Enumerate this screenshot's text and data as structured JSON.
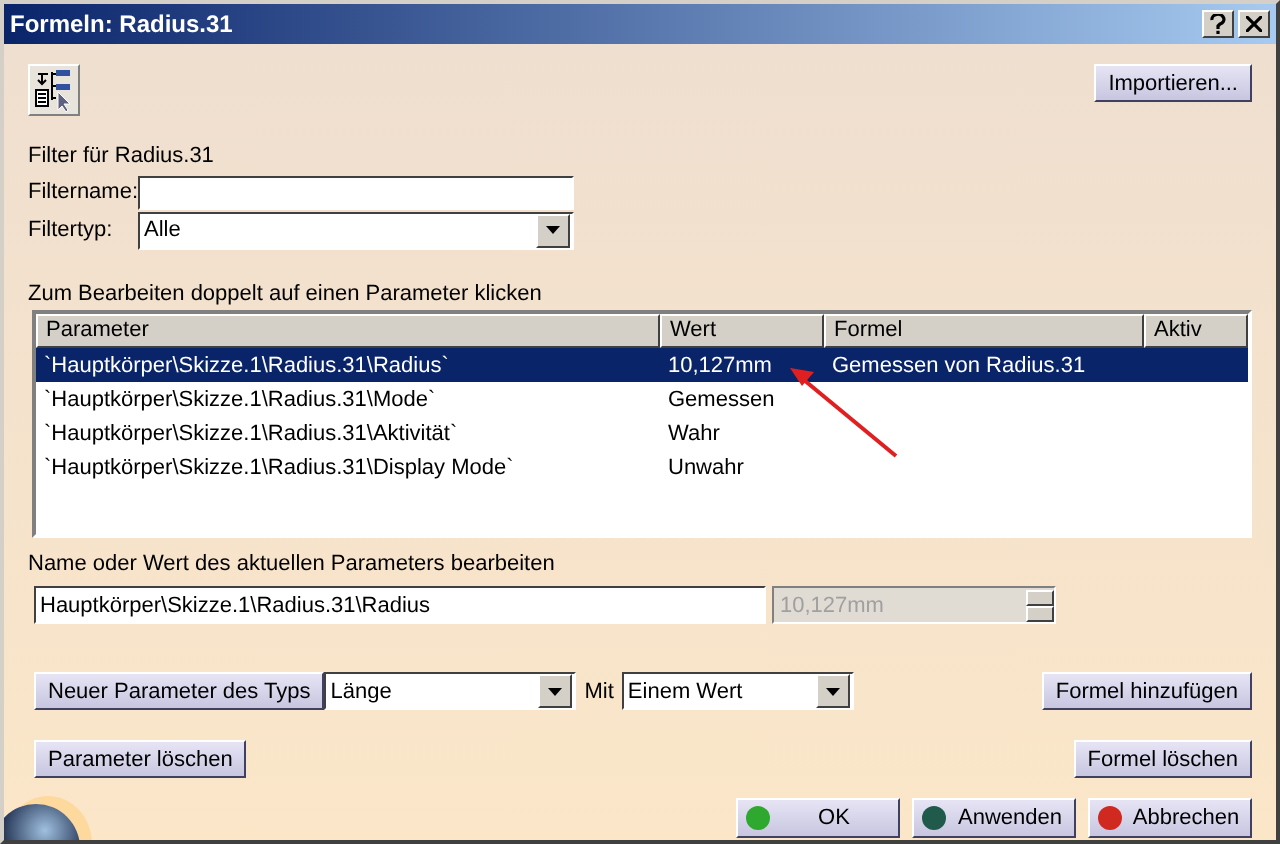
{
  "window": {
    "title": "Formeln: Radius.31"
  },
  "import_button": "Importieren...",
  "filter": {
    "heading": "Filter für Radius.31",
    "name_label": "Filtername:",
    "type_label": "Filtertyp:",
    "type_value": "Alle"
  },
  "table": {
    "caption": "Zum Bearbeiten doppelt auf einen Parameter klicken",
    "columns": [
      "Parameter",
      "Wert",
      "Formel",
      "Aktiv"
    ],
    "rows": [
      {
        "parameter": "`Hauptkörper\\Skizze.1\\Radius.31\\Radius`",
        "wert": "10,127mm",
        "formel": "Gemessen von Radius.31",
        "selected": true
      },
      {
        "parameter": "`Hauptkörper\\Skizze.1\\Radius.31\\Mode`",
        "wert": "Gemessen",
        "selected": false
      },
      {
        "parameter": "`Hauptkörper\\Skizze.1\\Radius.31\\Aktivität`",
        "wert": "Wahr",
        "selected": false
      },
      {
        "parameter": "`Hauptkörper\\Skizze.1\\Radius.31\\Display Mode`",
        "wert": "Unwahr",
        "selected": false
      }
    ]
  },
  "editor": {
    "label": "Name oder Wert des aktuellen Parameters bearbeiten",
    "name_value": "Hauptkörper\\Skizze.1\\Radius.31\\Radius",
    "value": "10,127mm",
    "value_disabled": true
  },
  "new_parameter": {
    "button": "Neuer Parameter des Typs",
    "type_value": "Länge",
    "with_label": "Mit",
    "mode_value": "Einem Wert",
    "add_formula_button": "Formel hinzufügen"
  },
  "delete_parameter_button": "Parameter löschen",
  "delete_formula_button": "Formel löschen",
  "dialog_buttons": [
    {
      "label": "OK",
      "color": "#2fa82f"
    },
    {
      "label": "Anwenden",
      "color": "#1f5a4a"
    },
    {
      "label": "Abbrechen",
      "color": "#d02a20"
    }
  ]
}
